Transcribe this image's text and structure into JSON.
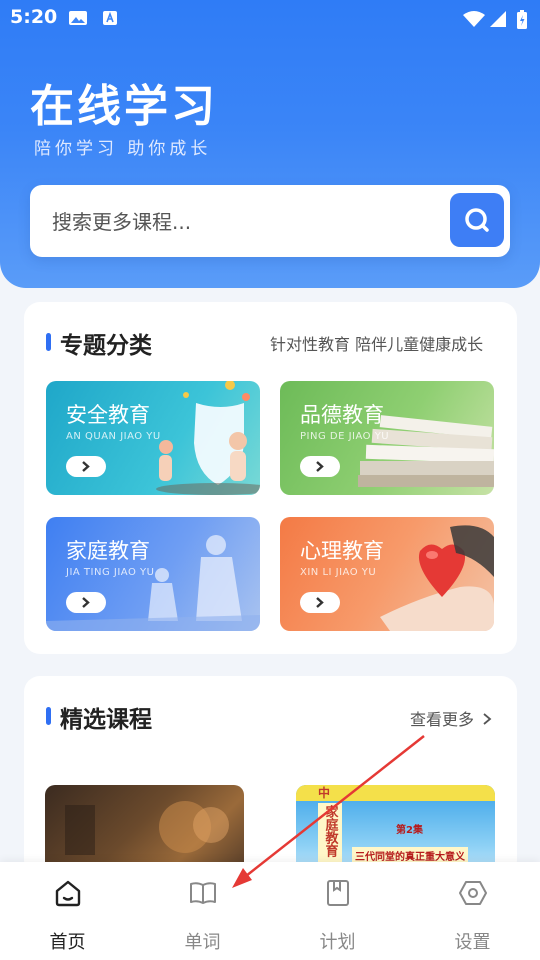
{
  "status": {
    "time": "5:20"
  },
  "hero": {
    "title": "在线学习",
    "subtitle": "陪你学习 助你成长"
  },
  "search": {
    "placeholder": "搜索更多课程..."
  },
  "topics": {
    "title": "专题分类",
    "subtitle": "针对性教育 陪伴儿童健康成长",
    "items": [
      {
        "title": "安全教育",
        "pinyin": "AN QUAN JIAO YU"
      },
      {
        "title": "品德教育",
        "pinyin": "PING DE JIAO YU"
      },
      {
        "title": "家庭教育",
        "pinyin": "JIA TING JIAO YU"
      },
      {
        "title": "心理教育",
        "pinyin": "XIN LI JIAO YU"
      }
    ]
  },
  "featured": {
    "title": "精选课程",
    "more": "查看更多",
    "courses": [
      {
        "thumb_text": ""
      },
      {
        "badge": "第2集",
        "headline": "三代同堂的真正重大意义",
        "side": "家庭教育",
        "top": "中"
      }
    ]
  },
  "tabs": [
    {
      "label": "首页",
      "icon": "home-icon",
      "active": true
    },
    {
      "label": "单词",
      "icon": "book-icon",
      "active": false
    },
    {
      "label": "计划",
      "icon": "notebook-icon",
      "active": false
    },
    {
      "label": "设置",
      "icon": "settings-icon",
      "active": false
    }
  ],
  "colors": {
    "accent": "#2f7cf6",
    "indicator": "#2f6ff3"
  }
}
